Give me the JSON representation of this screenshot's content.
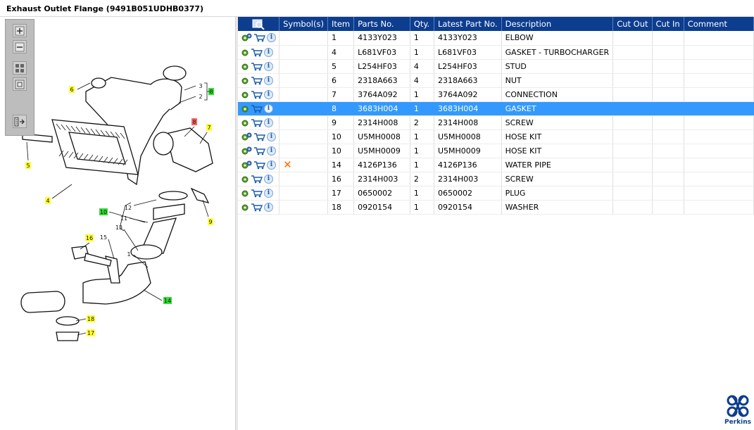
{
  "window": {
    "title": "Exhaust Outlet Flange (9491B051UDHB0377)"
  },
  "toolbar": {
    "buttons": [
      {
        "name": "zoom-in",
        "icon": "zoom-in-icon"
      },
      {
        "name": "zoom-out",
        "icon": "zoom-out-icon"
      },
      {
        "name": "fit-all",
        "icon": "fit-all-icon"
      },
      {
        "name": "fit-window",
        "icon": "fit-window-icon"
      },
      {
        "name": "export",
        "icon": "export-icon"
      }
    ]
  },
  "diagram": {
    "callouts": [
      {
        "label": "6",
        "color": "#ffff33"
      },
      {
        "label": "3",
        "color": "none"
      },
      {
        "label": "2",
        "color": "none"
      },
      {
        "label": "8",
        "color": "#33dd33"
      },
      {
        "label": "8",
        "color": "#ff6666"
      },
      {
        "label": "7",
        "color": "#ffff33"
      },
      {
        "label": "5",
        "color": "#ffff33"
      },
      {
        "label": "4",
        "color": "#ffff33"
      },
      {
        "label": "12",
        "color": "none"
      },
      {
        "label": "10",
        "color": "#33dd33"
      },
      {
        "label": "11",
        "color": "none"
      },
      {
        "label": "13",
        "color": "none"
      },
      {
        "label": "9",
        "color": "#ffff33"
      },
      {
        "label": "16",
        "color": "#ffff33"
      },
      {
        "label": "15",
        "color": "none"
      },
      {
        "label": "1",
        "color": "none"
      },
      {
        "label": "14",
        "color": "#33dd33"
      },
      {
        "label": "18",
        "color": "#ffff33"
      },
      {
        "label": "17",
        "color": "#ffff33"
      }
    ]
  },
  "table": {
    "columns": [
      "",
      "Symbol(s)",
      "Item",
      "Parts No.",
      "Qty.",
      "Latest Part No.",
      "Description",
      "Cut Out",
      "Cut In",
      "Comment"
    ],
    "rows": [
      {
        "item": "1",
        "part": "4133Y023",
        "qty": "1",
        "latest": "4133Y023",
        "desc": "ELBOW",
        "symbol": "",
        "tool": "gears-icon",
        "selected": false
      },
      {
        "item": "4",
        "part": "L681VF03",
        "qty": "1",
        "latest": "L681VF03",
        "desc": "GASKET - TURBOCHARGER",
        "symbol": "",
        "tool": "gear-icon",
        "selected": false
      },
      {
        "item": "5",
        "part": "L254HF03",
        "qty": "4",
        "latest": "L254HF03",
        "desc": "STUD",
        "symbol": "",
        "tool": "gear-icon",
        "selected": false
      },
      {
        "item": "6",
        "part": "2318A663",
        "qty": "4",
        "latest": "2318A663",
        "desc": "NUT",
        "symbol": "",
        "tool": "gear-icon",
        "selected": false
      },
      {
        "item": "7",
        "part": "3764A092",
        "qty": "1",
        "latest": "3764A092",
        "desc": "CONNECTION",
        "symbol": "",
        "tool": "gear-icon",
        "selected": false
      },
      {
        "item": "8",
        "part": "3683H004",
        "qty": "1",
        "latest": "3683H004",
        "desc": "GASKET",
        "symbol": "",
        "tool": "gear-icon",
        "selected": true
      },
      {
        "item": "9",
        "part": "2314H008",
        "qty": "2",
        "latest": "2314H008",
        "desc": "SCREW",
        "symbol": "",
        "tool": "gear-icon",
        "selected": false
      },
      {
        "item": "10",
        "part": "U5MH0008",
        "qty": "1",
        "latest": "U5MH0008",
        "desc": "HOSE KIT",
        "symbol": "",
        "tool": "gears-icon",
        "selected": false
      },
      {
        "item": "10",
        "part": "U5MH0009",
        "qty": "1",
        "latest": "U5MH0009",
        "desc": "HOSE KIT",
        "symbol": "",
        "tool": "gears-icon",
        "selected": false
      },
      {
        "item": "14",
        "part": "4126P136",
        "qty": "1",
        "latest": "4126P136",
        "desc": "WATER PIPE",
        "symbol": "x-mark-icon",
        "tool": "gears-icon",
        "selected": false
      },
      {
        "item": "16",
        "part": "2314H003",
        "qty": "2",
        "latest": "2314H003",
        "desc": "SCREW",
        "symbol": "",
        "tool": "gear-icon",
        "selected": false
      },
      {
        "item": "17",
        "part": "0650002",
        "qty": "1",
        "latest": "0650002",
        "desc": "PLUG",
        "symbol": "",
        "tool": "gear-icon",
        "selected": false
      },
      {
        "item": "18",
        "part": "0920154",
        "qty": "1",
        "latest": "0920154",
        "desc": "WASHER",
        "symbol": "",
        "tool": "gear-icon",
        "selected": false
      }
    ]
  },
  "logo": {
    "brand": "Perkins",
    "color": "#0d3d8e"
  },
  "colors": {
    "header": "#0d3d8e",
    "selected_row": "#3399ff",
    "symbol_x": "#ff6a00"
  }
}
